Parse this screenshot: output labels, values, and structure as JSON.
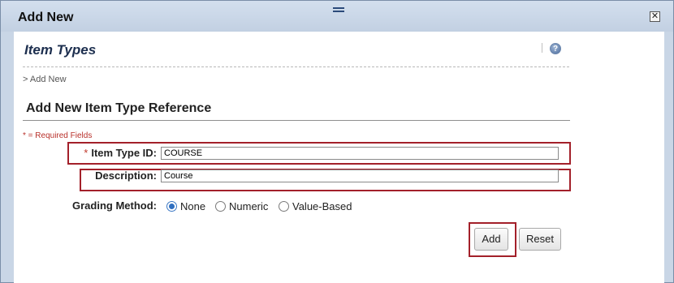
{
  "dialog": {
    "title": "Add New",
    "close_symbol": "✕"
  },
  "page": {
    "section_title": "Item Types",
    "help_symbol": "?",
    "breadcrumb": "> Add New"
  },
  "form": {
    "heading": "Add New Item Type Reference",
    "required_note": "* = Required Fields",
    "required_star": "*",
    "item_type_id": {
      "label": "Item Type ID:",
      "value": "COURSE"
    },
    "description": {
      "label": "Description:",
      "value": "Course"
    },
    "grading_method": {
      "label": "Grading Method:",
      "options": [
        {
          "label": "None",
          "selected": true
        },
        {
          "label": "Numeric",
          "selected": false
        },
        {
          "label": "Value-Based",
          "selected": false
        }
      ]
    },
    "buttons": {
      "add": "Add",
      "reset": "Reset"
    }
  },
  "icons": {
    "drag": "drag-handle-icon",
    "close": "close-icon",
    "help": "help-icon",
    "radio": "radio-button-icon"
  },
  "colors": {
    "title_bar": "#c9d6e6",
    "highlight": "#a3202a",
    "required": "#b8302a",
    "heading": "#1d2f4f"
  }
}
